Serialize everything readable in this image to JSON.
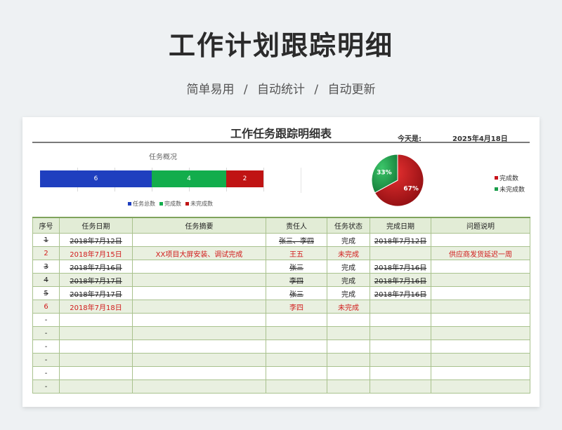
{
  "header": {
    "title": "工作计划跟踪明细",
    "tags": [
      "简单易用",
      "自动统计",
      "自动更新"
    ],
    "separator": "/"
  },
  "sheet": {
    "title": "工作任务跟踪明细表",
    "today_label": "今天是:",
    "today_value": "2025年4月18日"
  },
  "overview": {
    "title": "任务概况",
    "total": 6,
    "done": 4,
    "undone": 2,
    "legend": [
      "任务总数",
      "完成数",
      "未完成数"
    ],
    "colors": {
      "total": "#1f3fbf",
      "done": "#12ad4c",
      "undone": "#c01414"
    }
  },
  "pie": {
    "done_pct": 67,
    "undone_pct": 33,
    "done_label": "67%",
    "undone_label": "33%",
    "legend": [
      "完成数",
      "未完成数"
    ],
    "colors": {
      "done": "#c8141c",
      "undone": "#1a9e4a"
    }
  },
  "table": {
    "columns": [
      "序号",
      "任务日期",
      "任务摘要",
      "责任人",
      "任务状态",
      "完成日期",
      "问题说明"
    ],
    "rows": [
      [
        "1",
        "2018年7月12日",
        "",
        "张三、李四",
        "完成",
        "2018年7月12日",
        ""
      ],
      [
        "2",
        "2018年7月15日",
        "XX项目大屏安装、调试完成",
        "王五",
        "未完成",
        "",
        "供应商发货延迟一周"
      ],
      [
        "3",
        "2018年7月16日",
        "",
        "张三",
        "完成",
        "2018年7月16日",
        ""
      ],
      [
        "4",
        "2018年7月17日",
        "",
        "李四",
        "完成",
        "2018年7月16日",
        ""
      ],
      [
        "5",
        "2018年7月17日",
        "",
        "张三",
        "完成",
        "2018年7月16日",
        ""
      ],
      [
        "6",
        "2018年7月18日",
        "",
        "李四",
        "未完成",
        "",
        ""
      ],
      [
        "-",
        "",
        "",
        "",
        "",
        "",
        ""
      ],
      [
        "-",
        "",
        "",
        "",
        "",
        "",
        ""
      ],
      [
        "-",
        "",
        "",
        "",
        "",
        "",
        ""
      ],
      [
        "-",
        "",
        "",
        "",
        "",
        "",
        ""
      ],
      [
        "-",
        "",
        "",
        "",
        "",
        "",
        ""
      ],
      [
        "-",
        "",
        "",
        "",
        "",
        "",
        ""
      ]
    ],
    "status_done": "完成"
  }
}
